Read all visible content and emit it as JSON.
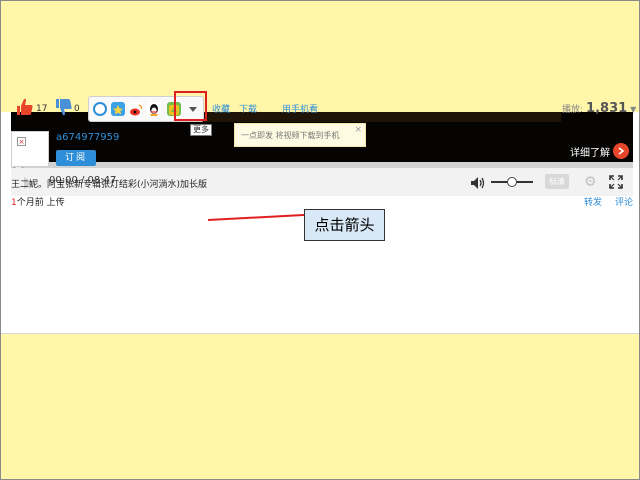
{
  "player": {
    "learn_more": "详细了解",
    "time_display": "00:00 / 08:47",
    "quality_label": "标清"
  },
  "actions": {
    "likes": "17",
    "dislikes": "0",
    "more_tooltip": "更多",
    "link_a": "收藏",
    "link_b": "下载",
    "link_c": "用手机看",
    "plays_label": "播放:",
    "plays_count": "1,831"
  },
  "tooltip": {
    "text": "一点即发 将视频下载到手机",
    "close": "×"
  },
  "uploader": {
    "name": "a674977959",
    "subscribe": "订阅"
  },
  "video": {
    "title": "王二妮。阿宝张新专辑张灯结彩(小河淌水)加长版",
    "upload_num": "1",
    "upload_rest": "个月前 上传",
    "forward": "转发",
    "comment": "评论"
  },
  "annotation": {
    "callout": "点击箭头"
  },
  "colors": {
    "slide_background": "#fff6a9",
    "accent_red": "#e02020",
    "link_blue": "#2f8ed8"
  }
}
